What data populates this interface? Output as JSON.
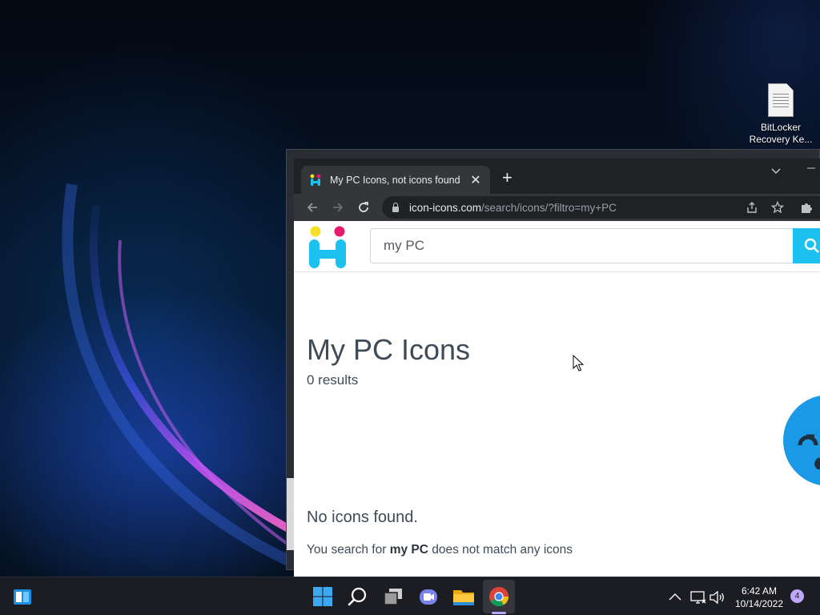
{
  "desktop": {
    "icons": [
      {
        "name_line1": "BitLocker",
        "name_line2": "Recovery Ke..."
      }
    ]
  },
  "browser": {
    "tab": {
      "title": "My PC Icons, not icons found",
      "close_glyph": "✕"
    },
    "new_tab_glyph": "+",
    "address": {
      "host": "icon-icons.com",
      "path": "/search/icons/?filtro=my+PC"
    }
  },
  "page": {
    "search": {
      "value": "my PC"
    },
    "title": "My PC Icons",
    "result_count": "0 results",
    "empty_title": "No icons found.",
    "empty_message": {
      "prefix": "You search for ",
      "query": "my PC",
      "suffix": " does not match any icons"
    }
  },
  "taskbar": {
    "apps": [
      "widgets",
      "start",
      "search",
      "task-view",
      "teams-chat",
      "file-explorer",
      "chrome"
    ],
    "active_app": "chrome",
    "clock": {
      "time": "6:42 AM",
      "date": "10/14/2022"
    },
    "notifications": "4"
  },
  "colors": {
    "accent": "#1cc1f0",
    "browser_dark": "#202124",
    "taskbar": "#1c1d22"
  }
}
